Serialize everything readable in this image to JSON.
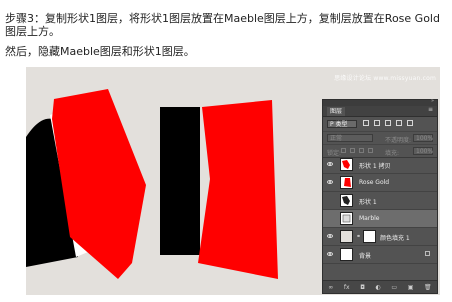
{
  "article": {
    "step_label": "步骤3：",
    "step_text": "复制形状1图层，将形状1图层放置在Maeble图层上方，复制层放置在Rose Gold图层上方。",
    "paragraph_2": "然后，隐藏Maeble图层和形状1图层。"
  },
  "watermark": "思缘设计论坛 www.missyuan.com",
  "colors": {
    "canvas_bg": "#e3e0dc",
    "red": "#ff0000",
    "black": "#000000",
    "panel_bg": "#535353"
  },
  "layers_panel": {
    "tab_label": "图层",
    "menu_icon": "panel-menu-icon",
    "kind_label": "P 类型",
    "mode_label": "正常",
    "opacity_label": "不透明度:",
    "opacity_value": "100%",
    "lock_label": "锁定:",
    "fill_label": "填充:",
    "fill_value": "100%",
    "layers": [
      {
        "name": "形状 1 拷贝",
        "visible": true,
        "selected": false,
        "kind": "shape"
      },
      {
        "name": "Rose Gold",
        "visible": true,
        "selected": false,
        "kind": "shape"
      },
      {
        "name": "形状 1",
        "visible": false,
        "selected": false,
        "kind": "shape"
      },
      {
        "name": "Marble",
        "visible": false,
        "selected": true,
        "kind": "smart"
      },
      {
        "name": "颜色填充 1",
        "visible": true,
        "selected": false,
        "kind": "fill"
      },
      {
        "name": "背景",
        "visible": true,
        "selected": false,
        "kind": "background",
        "locked": true
      }
    ],
    "footer_icons": [
      "link-icon",
      "fx-icon",
      "mask-icon",
      "adjustment-icon",
      "folder-icon",
      "new-layer-icon",
      "trash-icon"
    ],
    "footer_glyphs": [
      "∞",
      "fx",
      "◘",
      "◐",
      "▭",
      "▣",
      "🗑"
    ]
  }
}
